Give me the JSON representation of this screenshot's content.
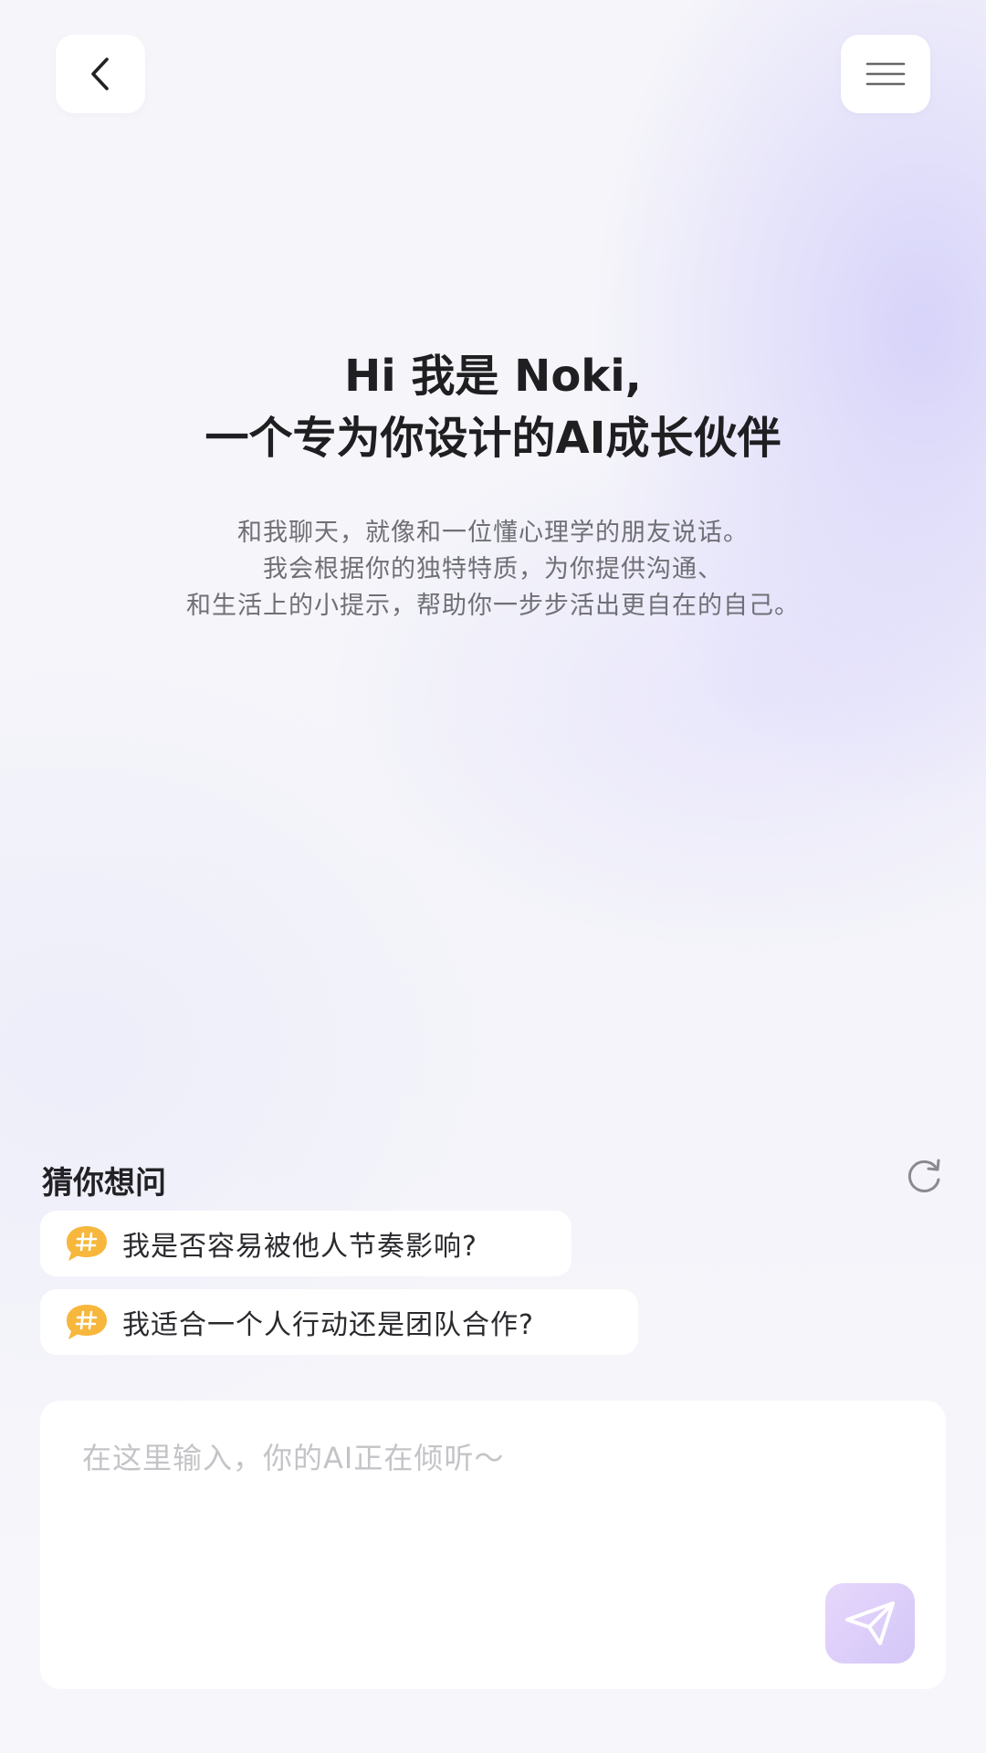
{
  "header": {
    "back_icon": "chevron-left-icon",
    "menu_icon": "hamburger-menu-icon"
  },
  "welcome": {
    "title_line1": "Hi 我是 Noki,",
    "title_line2": "一个专为你设计的AI成长伙伴",
    "intro_line1": "和我聊天，就像和一位懂心理学的朋友说话。",
    "intro_line2": "我会根据你的独特特质，为你提供沟通、",
    "intro_line3": "和生活上的小提示，帮助你一步步活出更自在的自己。"
  },
  "suggestions": {
    "title": "猜你想问",
    "refresh_icon": "refresh-icon",
    "items": [
      {
        "icon": "hash-bubble-icon",
        "text": "我是否容易被他人节奏影响?"
      },
      {
        "icon": "hash-bubble-icon",
        "text": "我适合一个人行动还是团队合作?"
      }
    ]
  },
  "composer": {
    "placeholder": "在这里输入，你的AI正在倾听～",
    "value": "",
    "send_icon": "paper-plane-icon"
  },
  "colors": {
    "accent_bubble": "#F6B73C",
    "send_button": "#DCCEF9",
    "title_text": "#1F1F22",
    "body_text": "#6F6F76"
  }
}
